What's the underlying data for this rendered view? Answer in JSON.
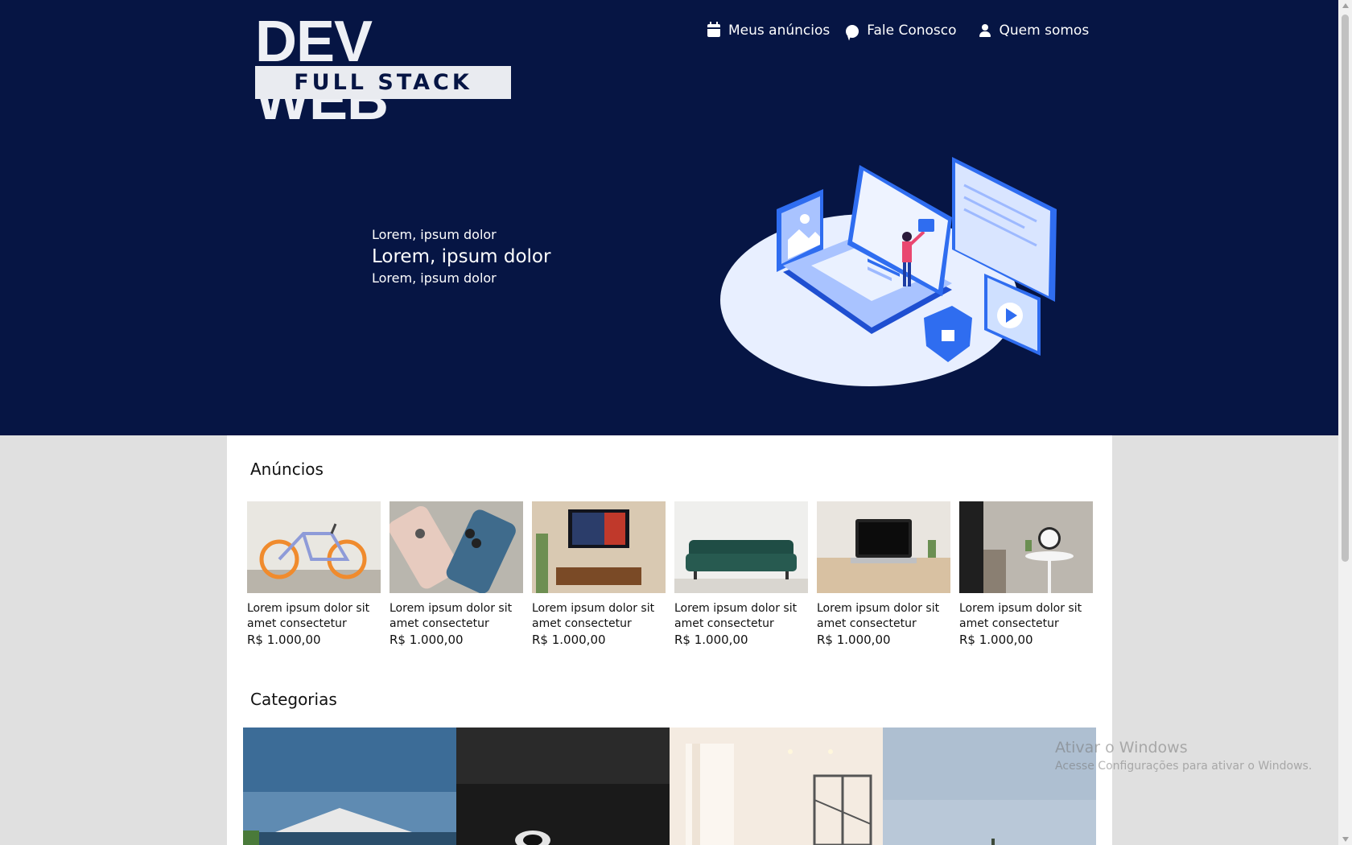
{
  "brand": {
    "line1": "DEV WEB",
    "line2": "FULL STACK"
  },
  "nav": [
    {
      "label": "Meus anúncios",
      "icon": "calendar-icon"
    },
    {
      "label": "Fale Conosco",
      "icon": "chat-icon"
    },
    {
      "label": "Quem somos",
      "icon": "user-icon"
    }
  ],
  "hero": {
    "line1": "Lorem, ipsum dolor",
    "line2": "Lorem, ipsum dolor",
    "line3": "Lorem, ipsum dolor"
  },
  "sections": {
    "ads_title": "Anúncios",
    "categories_title": "Categorias"
  },
  "ads": [
    {
      "title": "Lorem ipsum dolor sit amet consectetur",
      "price": "R$ 1.000,00",
      "image": "bicycle"
    },
    {
      "title": "Lorem ipsum dolor sit amet consectetur",
      "price": "R$ 1.000,00",
      "image": "smartphones"
    },
    {
      "title": "Lorem ipsum dolor sit amet consectetur",
      "price": "R$ 1.000,00",
      "image": "television"
    },
    {
      "title": "Lorem ipsum dolor sit amet consectetur",
      "price": "R$ 1.000,00",
      "image": "sofa"
    },
    {
      "title": "Lorem ipsum dolor sit amet consectetur",
      "price": "R$ 1.000,00",
      "image": "laptop"
    },
    {
      "title": "Lorem ipsum dolor sit amet consectetur",
      "price": "R$ 1.000,00",
      "image": "alarm-clock"
    }
  ],
  "categories": [
    {
      "image": "house"
    },
    {
      "image": "camera"
    },
    {
      "image": "interior-room"
    },
    {
      "image": "sky"
    }
  ],
  "watermark": {
    "title": "Ativar o Windows",
    "subtitle": "Acesse Configurações para ativar o Windows."
  },
  "colors": {
    "hero_bg": "#061544",
    "page_bg": "#e0e0e0",
    "panel_bg": "#ffffff"
  }
}
